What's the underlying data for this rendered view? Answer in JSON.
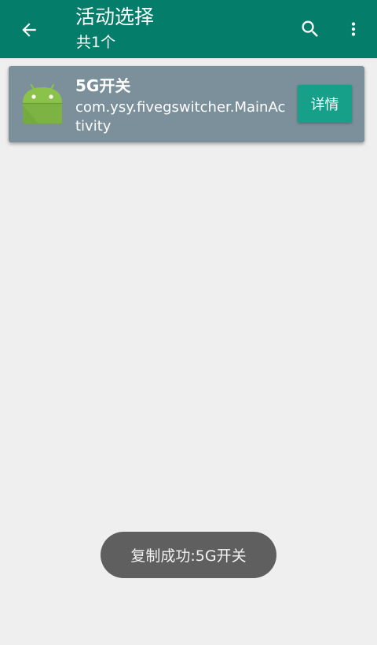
{
  "colors": {
    "appbar": "#047e6a",
    "background": "#efefef",
    "card": "#7b909b",
    "detail_button": "#16a08a",
    "toast": "#5f5f5f",
    "android_icon": "#8bc34a"
  },
  "appbar": {
    "title": "活动选择",
    "subtitle": "共1个",
    "back_icon": "arrow-back-icon",
    "search_icon": "search-icon",
    "more_icon": "more-vert-icon"
  },
  "list": {
    "items": [
      {
        "icon": "android-app-icon",
        "app_name": "5G开关",
        "activity": "com.ysy.fivegswitcher.MainActivity",
        "detail_label": "详情"
      }
    ]
  },
  "toast": {
    "message": "复制成功:5G开关"
  }
}
